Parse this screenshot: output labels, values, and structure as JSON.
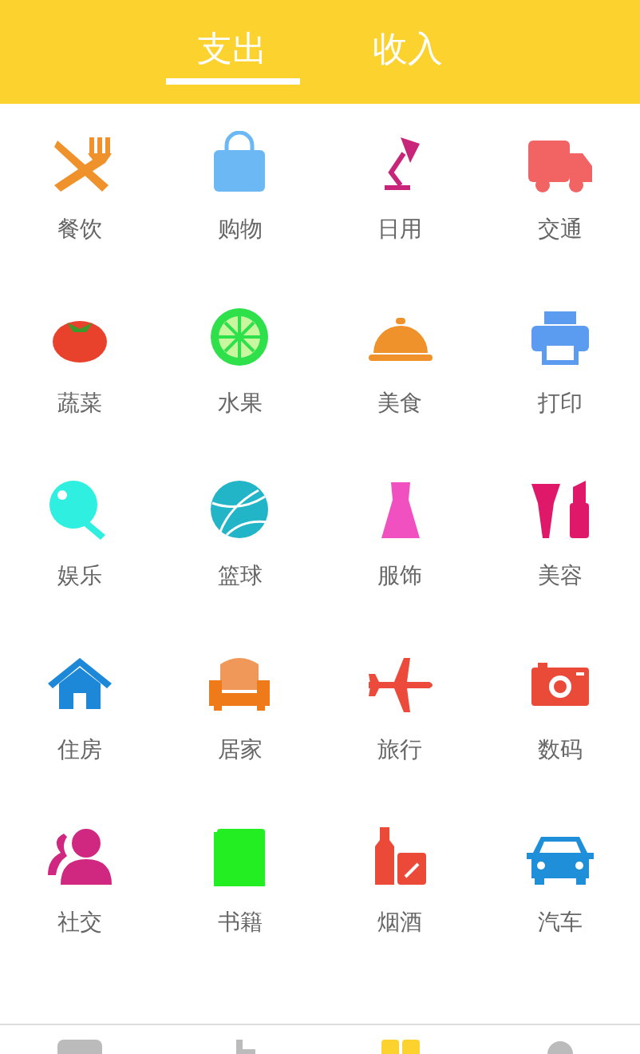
{
  "tabs": [
    {
      "label": "支出",
      "selected": true
    },
    {
      "label": "收入",
      "selected": false
    }
  ],
  "categories": [
    {
      "label": "餐饮",
      "kind": "dining"
    },
    {
      "label": "购物",
      "kind": "shopping"
    },
    {
      "label": "日用",
      "kind": "daily"
    },
    {
      "label": "交通",
      "kind": "transport"
    },
    {
      "label": "蔬菜",
      "kind": "vegetable"
    },
    {
      "label": "水果",
      "kind": "fruit"
    },
    {
      "label": "美食",
      "kind": "food"
    },
    {
      "label": "打印",
      "kind": "print"
    },
    {
      "label": "娱乐",
      "kind": "entertainment"
    },
    {
      "label": "篮球",
      "kind": "basketball"
    },
    {
      "label": "服饰",
      "kind": "clothing"
    },
    {
      "label": "美容",
      "kind": "beauty"
    },
    {
      "label": "住房",
      "kind": "housing"
    },
    {
      "label": "居家",
      "kind": "home"
    },
    {
      "label": "旅行",
      "kind": "travel"
    },
    {
      "label": "数码",
      "kind": "digital"
    },
    {
      "label": "社交",
      "kind": "social"
    },
    {
      "label": "书籍",
      "kind": "books"
    },
    {
      "label": "烟酒",
      "kind": "tobacco"
    },
    {
      "label": "汽车",
      "kind": "car"
    }
  ],
  "bottom_nav": [
    {
      "selected": false
    },
    {
      "selected": false
    },
    {
      "selected": true
    },
    {
      "selected": false
    }
  ]
}
